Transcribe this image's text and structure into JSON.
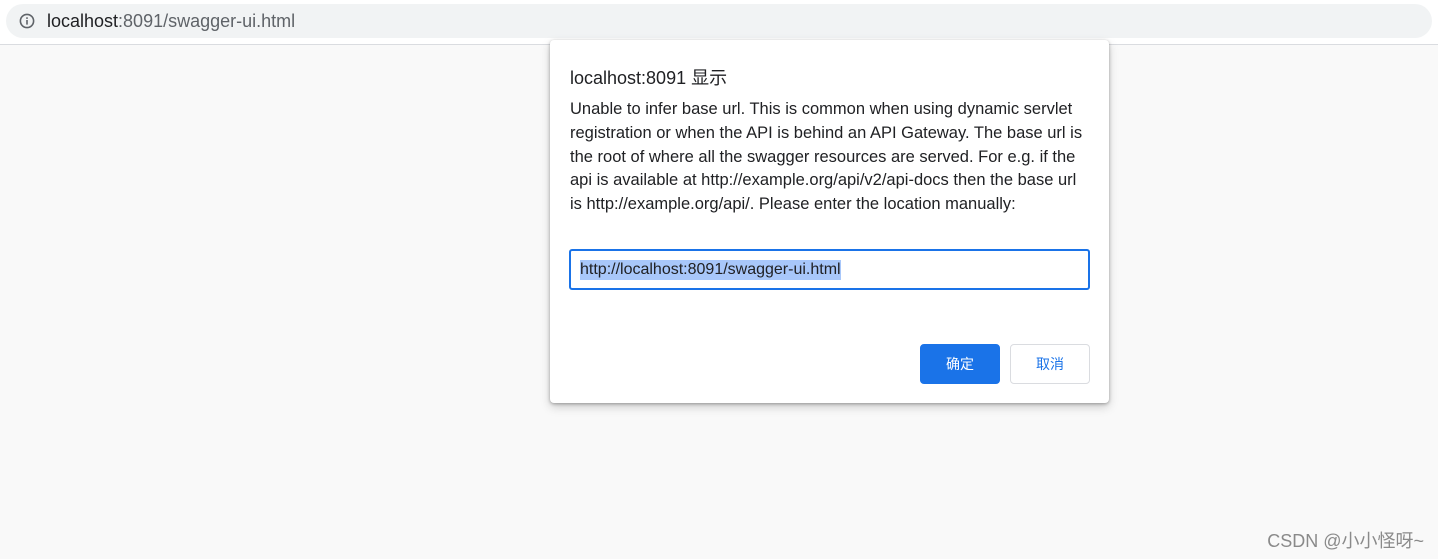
{
  "browser": {
    "url_host": "localhost",
    "url_rest": ":8091/swagger-ui.html",
    "icons": {
      "site_info": "info-circle-icon"
    }
  },
  "dialog": {
    "title": "localhost:8091 显示",
    "message": "Unable to infer base url. This is common when using dynamic servlet registration or when the API is behind an API Gateway. The base url is the root of where all the swagger resources are served. For e.g. if the api is available at http://example.org/api/v2/api-docs then the base url is http://example.org/api/. Please enter the location manually:",
    "input_value": "http://localhost:8091/swagger-ui.html",
    "ok_label": "确定",
    "cancel_label": "取消"
  },
  "watermark": "CSDN @小小怪呀~",
  "colors": {
    "accent": "#1a73e8",
    "selection": "#a8c7fa",
    "page_background": "#f9f9f9",
    "address_background": "#f1f3f4"
  }
}
